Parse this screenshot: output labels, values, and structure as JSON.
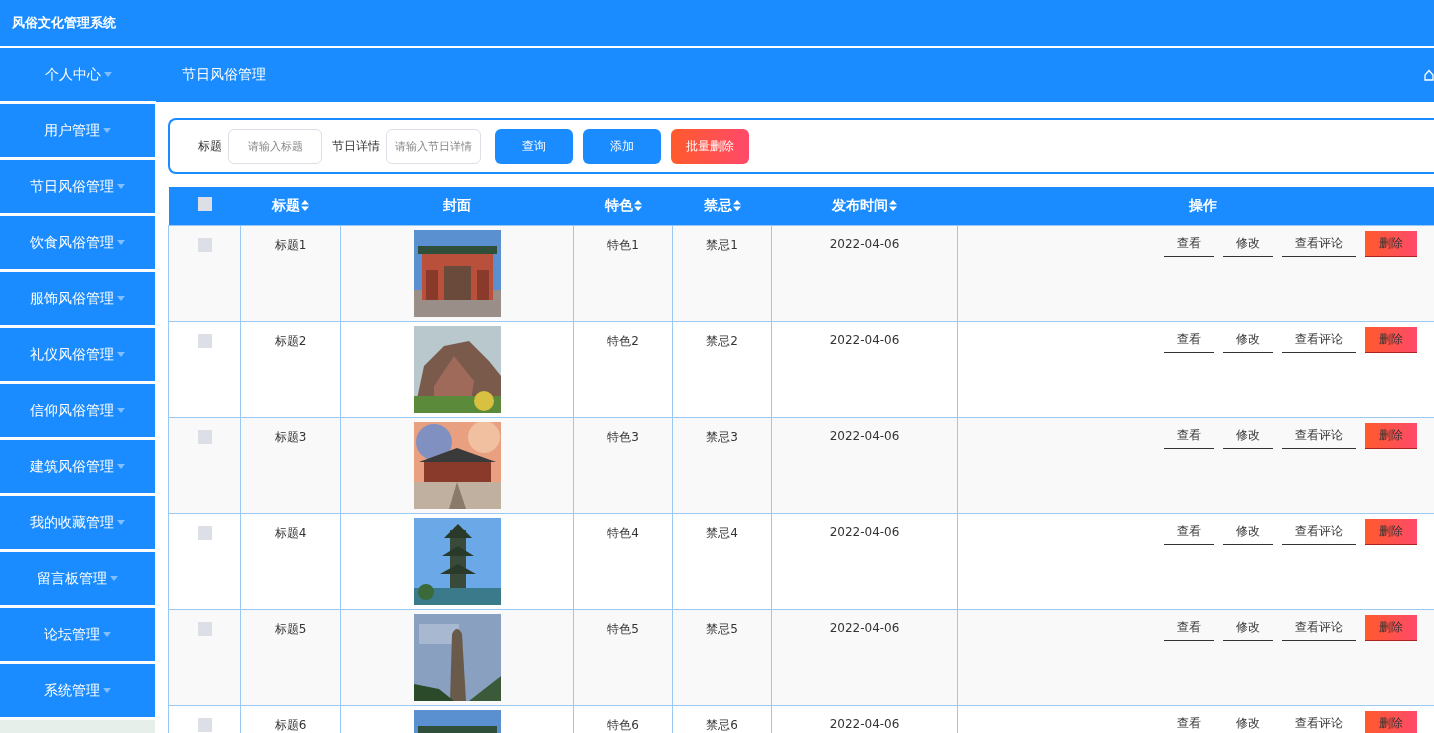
{
  "app_title": "风俗文化管理系统",
  "sidebar": {
    "items": [
      {
        "label": "个人中心"
      },
      {
        "label": "用户管理"
      },
      {
        "label": "节日风俗管理"
      },
      {
        "label": "饮食风俗管理"
      },
      {
        "label": "服饰风俗管理"
      },
      {
        "label": "礼仪风俗管理"
      },
      {
        "label": "信仰风俗管理"
      },
      {
        "label": "建筑风俗管理"
      },
      {
        "label": "我的收藏管理"
      },
      {
        "label": "留言板管理"
      },
      {
        "label": "论坛管理"
      },
      {
        "label": "系统管理"
      }
    ]
  },
  "breadcrumb": "节日风俗管理",
  "search": {
    "fields": [
      {
        "label": "标题",
        "placeholder": "请输入标题"
      },
      {
        "label": "节日详情",
        "placeholder": "请输入节日详情"
      }
    ],
    "buttons": [
      {
        "label": "查询",
        "kind": "primary"
      },
      {
        "label": "添加",
        "kind": "primary"
      },
      {
        "label": "批量删除",
        "kind": "danger"
      }
    ]
  },
  "table": {
    "select_all": {
      "checked": false
    },
    "columns": [
      {
        "label": "标题",
        "sortable": true
      },
      {
        "label": "封面",
        "sortable": false
      },
      {
        "label": "特色",
        "sortable": true
      },
      {
        "label": "禁忌",
        "sortable": true
      },
      {
        "label": "发布时间",
        "sortable": true
      },
      {
        "label": "操作",
        "sortable": false
      }
    ],
    "rows": [
      {
        "checked": false,
        "title": "标题1",
        "feature": "特色1",
        "taboo": "禁忌1",
        "date": "2022-04-06",
        "actions": [
          {
            "label": "查看",
            "kind": "link"
          },
          {
            "label": "修改",
            "kind": "link"
          },
          {
            "label": "查看评论",
            "kind": "link"
          },
          {
            "label": "删除",
            "kind": "danger"
          }
        ]
      },
      {
        "checked": false,
        "title": "标题2",
        "feature": "特色2",
        "taboo": "禁忌2",
        "date": "2022-04-06",
        "actions": [
          {
            "label": "查看",
            "kind": "link"
          },
          {
            "label": "修改",
            "kind": "link"
          },
          {
            "label": "查看评论",
            "kind": "link"
          },
          {
            "label": "删除",
            "kind": "danger"
          }
        ]
      },
      {
        "checked": false,
        "title": "标题3",
        "feature": "特色3",
        "taboo": "禁忌3",
        "date": "2022-04-06",
        "actions": [
          {
            "label": "查看",
            "kind": "link"
          },
          {
            "label": "修改",
            "kind": "link"
          },
          {
            "label": "查看评论",
            "kind": "link"
          },
          {
            "label": "删除",
            "kind": "danger"
          }
        ]
      },
      {
        "checked": false,
        "title": "标题4",
        "feature": "特色4",
        "taboo": "禁忌4",
        "date": "2022-04-06",
        "actions": [
          {
            "label": "查看",
            "kind": "link"
          },
          {
            "label": "修改",
            "kind": "link"
          },
          {
            "label": "查看评论",
            "kind": "link"
          },
          {
            "label": "删除",
            "kind": "danger"
          }
        ]
      },
      {
        "checked": false,
        "title": "标题5",
        "feature": "特色5",
        "taboo": "禁忌5",
        "date": "2022-04-06",
        "actions": [
          {
            "label": "查看",
            "kind": "link"
          },
          {
            "label": "修改",
            "kind": "link"
          },
          {
            "label": "查看评论",
            "kind": "link"
          },
          {
            "label": "删除",
            "kind": "danger"
          }
        ]
      },
      {
        "checked": false,
        "title": "标题6",
        "feature": "特色6",
        "taboo": "禁忌6",
        "date": "2022-04-06",
        "actions": [
          {
            "label": "查看",
            "kind": "link"
          },
          {
            "label": "修改",
            "kind": "link"
          },
          {
            "label": "查看评论",
            "kind": "link"
          },
          {
            "label": "删除",
            "kind": "danger"
          }
        ]
      }
    ]
  }
}
